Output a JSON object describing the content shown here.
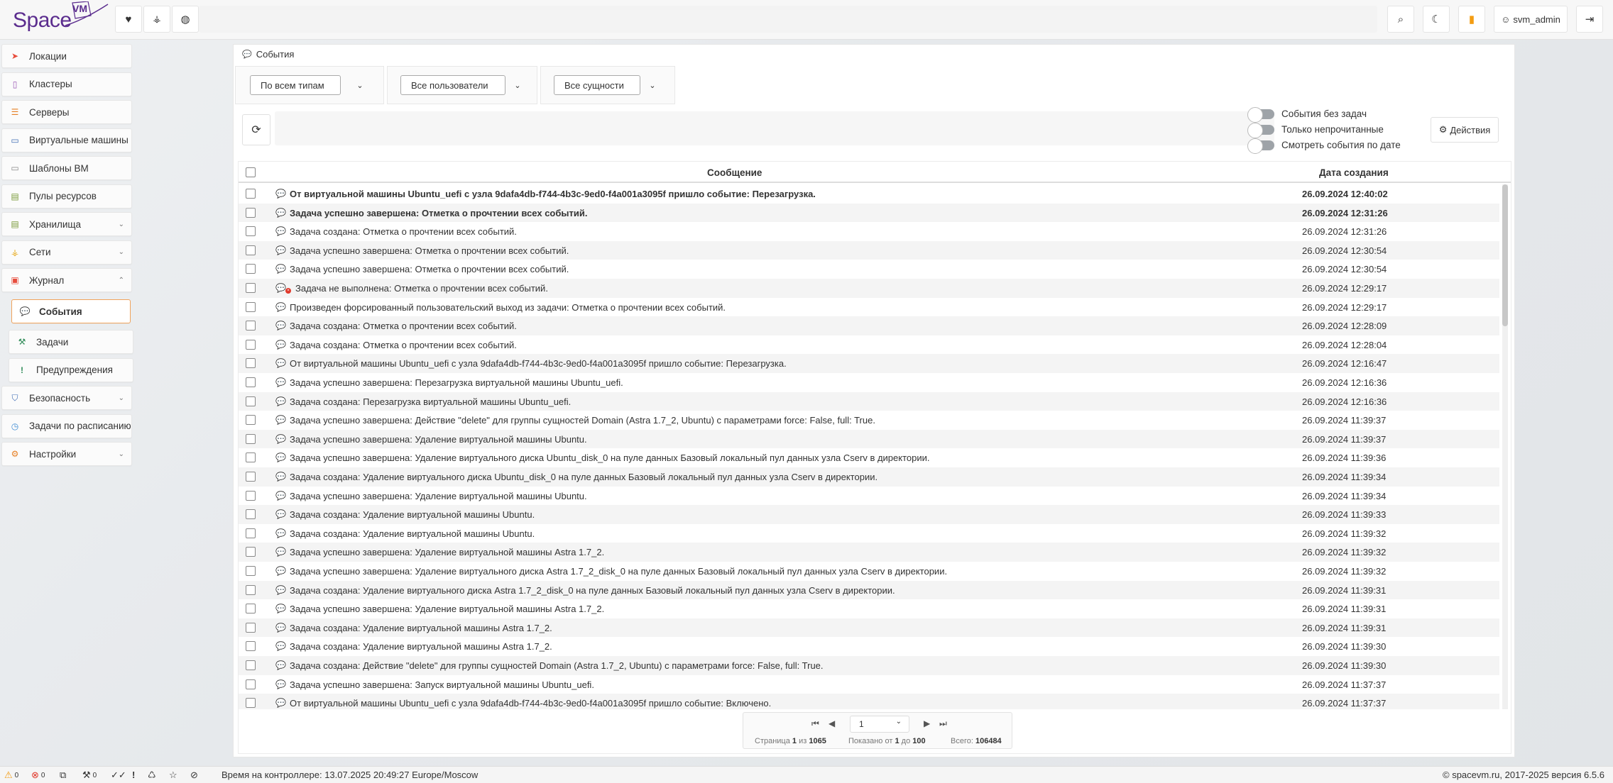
{
  "app": {
    "logo_text": "Space",
    "logo_badge": "VM"
  },
  "topbar": {
    "user_name": "svm_admin"
  },
  "sidebar": {
    "items": [
      {
        "label": "Локации"
      },
      {
        "label": "Кластеры"
      },
      {
        "label": "Серверы"
      },
      {
        "label": "Виртуальные машины"
      },
      {
        "label": "Шаблоны ВМ"
      },
      {
        "label": "Пулы ресурсов"
      },
      {
        "label": "Хранилища"
      },
      {
        "label": "Сети"
      },
      {
        "label": "Журнал"
      },
      {
        "label": "События"
      },
      {
        "label": "Задачи"
      },
      {
        "label": "Предупреждения"
      },
      {
        "label": "Безопасность"
      },
      {
        "label": "Задачи по расписанию"
      },
      {
        "label": "Настройки"
      }
    ]
  },
  "main": {
    "breadcrumb": "События",
    "filters": {
      "type": "По всем типам",
      "users": "Все пользователи",
      "entities": "Все сущности"
    },
    "toggles": {
      "without_tasks": "События без задач",
      "unread_only": "Только непрочитанные",
      "by_date": "Смотреть события по дате"
    },
    "actions_label": "Действия",
    "table": {
      "col_message": "Сообщение",
      "col_date": "Дата создания",
      "rows": [
        {
          "message": "От виртуальной машины Ubuntu_uefi с узла 9dafa4db-f744-4b3c-9ed0-f4a001a3095f пришло событие: Перезагрузка.",
          "date": "26.09.2024 12:40:02"
        },
        {
          "message": "Задача успешно завершена: Отметка о прочтении всех событий.",
          "date": "26.09.2024 12:31:26"
        },
        {
          "message": "Задача создана: Отметка о прочтении всех событий.",
          "date": "26.09.2024 12:31:26"
        },
        {
          "message": "Задача успешно завершена: Отметка о прочтении всех событий.",
          "date": "26.09.2024 12:30:54"
        },
        {
          "message": "Задача успешно завершена: Отметка о прочтении всех событий.",
          "date": "26.09.2024 12:30:54"
        },
        {
          "message": "Задача не выполнена: Отметка о прочтении всех событий.",
          "date": "26.09.2024 12:29:17"
        },
        {
          "message": "Произведен форсированный пользовательский выход из задачи: Отметка о прочтении всех событий.",
          "date": "26.09.2024 12:29:17"
        },
        {
          "message": "Задача создана: Отметка о прочтении всех событий.",
          "date": "26.09.2024 12:28:09"
        },
        {
          "message": "Задача создана: Отметка о прочтении всех событий.",
          "date": "26.09.2024 12:28:04"
        },
        {
          "message": "От виртуальной машины Ubuntu_uefi с узла 9dafa4db-f744-4b3c-9ed0-f4a001a3095f пришло событие: Перезагрузка.",
          "date": "26.09.2024 12:16:47"
        },
        {
          "message": "Задача успешно завершена: Перезагрузка виртуальной машины Ubuntu_uefi.",
          "date": "26.09.2024 12:16:36"
        },
        {
          "message": "Задача создана: Перезагрузка виртуальной машины Ubuntu_uefi.",
          "date": "26.09.2024 12:16:36"
        },
        {
          "message": "Задача успешно завершена: Действие \"delete\" для группы сущностей Domain (Astra 1.7_2, Ubuntu) с параметрами force: False, full: True.",
          "date": "26.09.2024 11:39:37"
        },
        {
          "message": "Задача успешно завершена: Удаление виртуальной машины Ubuntu.",
          "date": "26.09.2024 11:39:37"
        },
        {
          "message": "Задача успешно завершена: Удаление виртуального диска Ubuntu_disk_0 на пуле данных Базовый локальный пул данных узла Cserv в директории.",
          "date": "26.09.2024 11:39:36"
        },
        {
          "message": "Задача создана: Удаление виртуального диска Ubuntu_disk_0 на пуле данных Базовый локальный пул данных узла Cserv в директории.",
          "date": "26.09.2024 11:39:34"
        },
        {
          "message": "Задача успешно завершена: Удаление виртуальной машины Ubuntu.",
          "date": "26.09.2024 11:39:34"
        },
        {
          "message": "Задача создана: Удаление виртуальной машины Ubuntu.",
          "date": "26.09.2024 11:39:33"
        },
        {
          "message": "Задача создана: Удаление виртуальной машины Ubuntu.",
          "date": "26.09.2024 11:39:32"
        },
        {
          "message": "Задача успешно завершена: Удаление виртуальной машины Astra 1.7_2.",
          "date": "26.09.2024 11:39:32"
        },
        {
          "message": "Задача успешно завершена: Удаление виртуального диска Astra 1.7_2_disk_0 на пуле данных Базовый локальный пул данных узла Cserv в директории.",
          "date": "26.09.2024 11:39:32"
        },
        {
          "message": "Задача создана: Удаление виртуального диска Astra 1.7_2_disk_0 на пуле данных Базовый локальный пул данных узла Cserv в директории.",
          "date": "26.09.2024 11:39:31"
        },
        {
          "message": "Задача успешно завершена: Удаление виртуальной машины Astra 1.7_2.",
          "date": "26.09.2024 11:39:31"
        },
        {
          "message": "Задача создана: Удаление виртуальной машины Astra 1.7_2.",
          "date": "26.09.2024 11:39:31"
        },
        {
          "message": "Задача создана: Удаление виртуальной машины Astra 1.7_2.",
          "date": "26.09.2024 11:39:30"
        },
        {
          "message": "Задача создана: Действие \"delete\" для группы сущностей Domain (Astra 1.7_2, Ubuntu) с параметрами force: False, full: True.",
          "date": "26.09.2024 11:39:30"
        },
        {
          "message": "Задача успешно завершена: Запуск виртуальной машины Ubuntu_uefi.",
          "date": "26.09.2024 11:37:37"
        },
        {
          "message": "От виртуальной машины Ubuntu_uefi с узла 9dafa4db-f744-4b3c-9ed0-f4a001a3095f пришло событие: Включено.",
          "date": "26.09.2024 11:37:37"
        }
      ]
    },
    "pager": {
      "page_value": "1",
      "page_label": "Страница",
      "page_current": "1",
      "page_of": "из",
      "page_total": "1065",
      "shown_label": "Показано от",
      "shown_from": "1",
      "shown_to_label": "до",
      "shown_to": "100",
      "total_label": "Всего:",
      "total": "106484"
    }
  },
  "statusbar": {
    "warn_count": "0",
    "error_count": "0",
    "tasks_count": "0",
    "controller_time": "Время на контроллере: 13.07.2025 20:49:27 Europe/Moscow",
    "copyright": "© spacevm.ru, 2017-2025 версия 6.5.6"
  }
}
